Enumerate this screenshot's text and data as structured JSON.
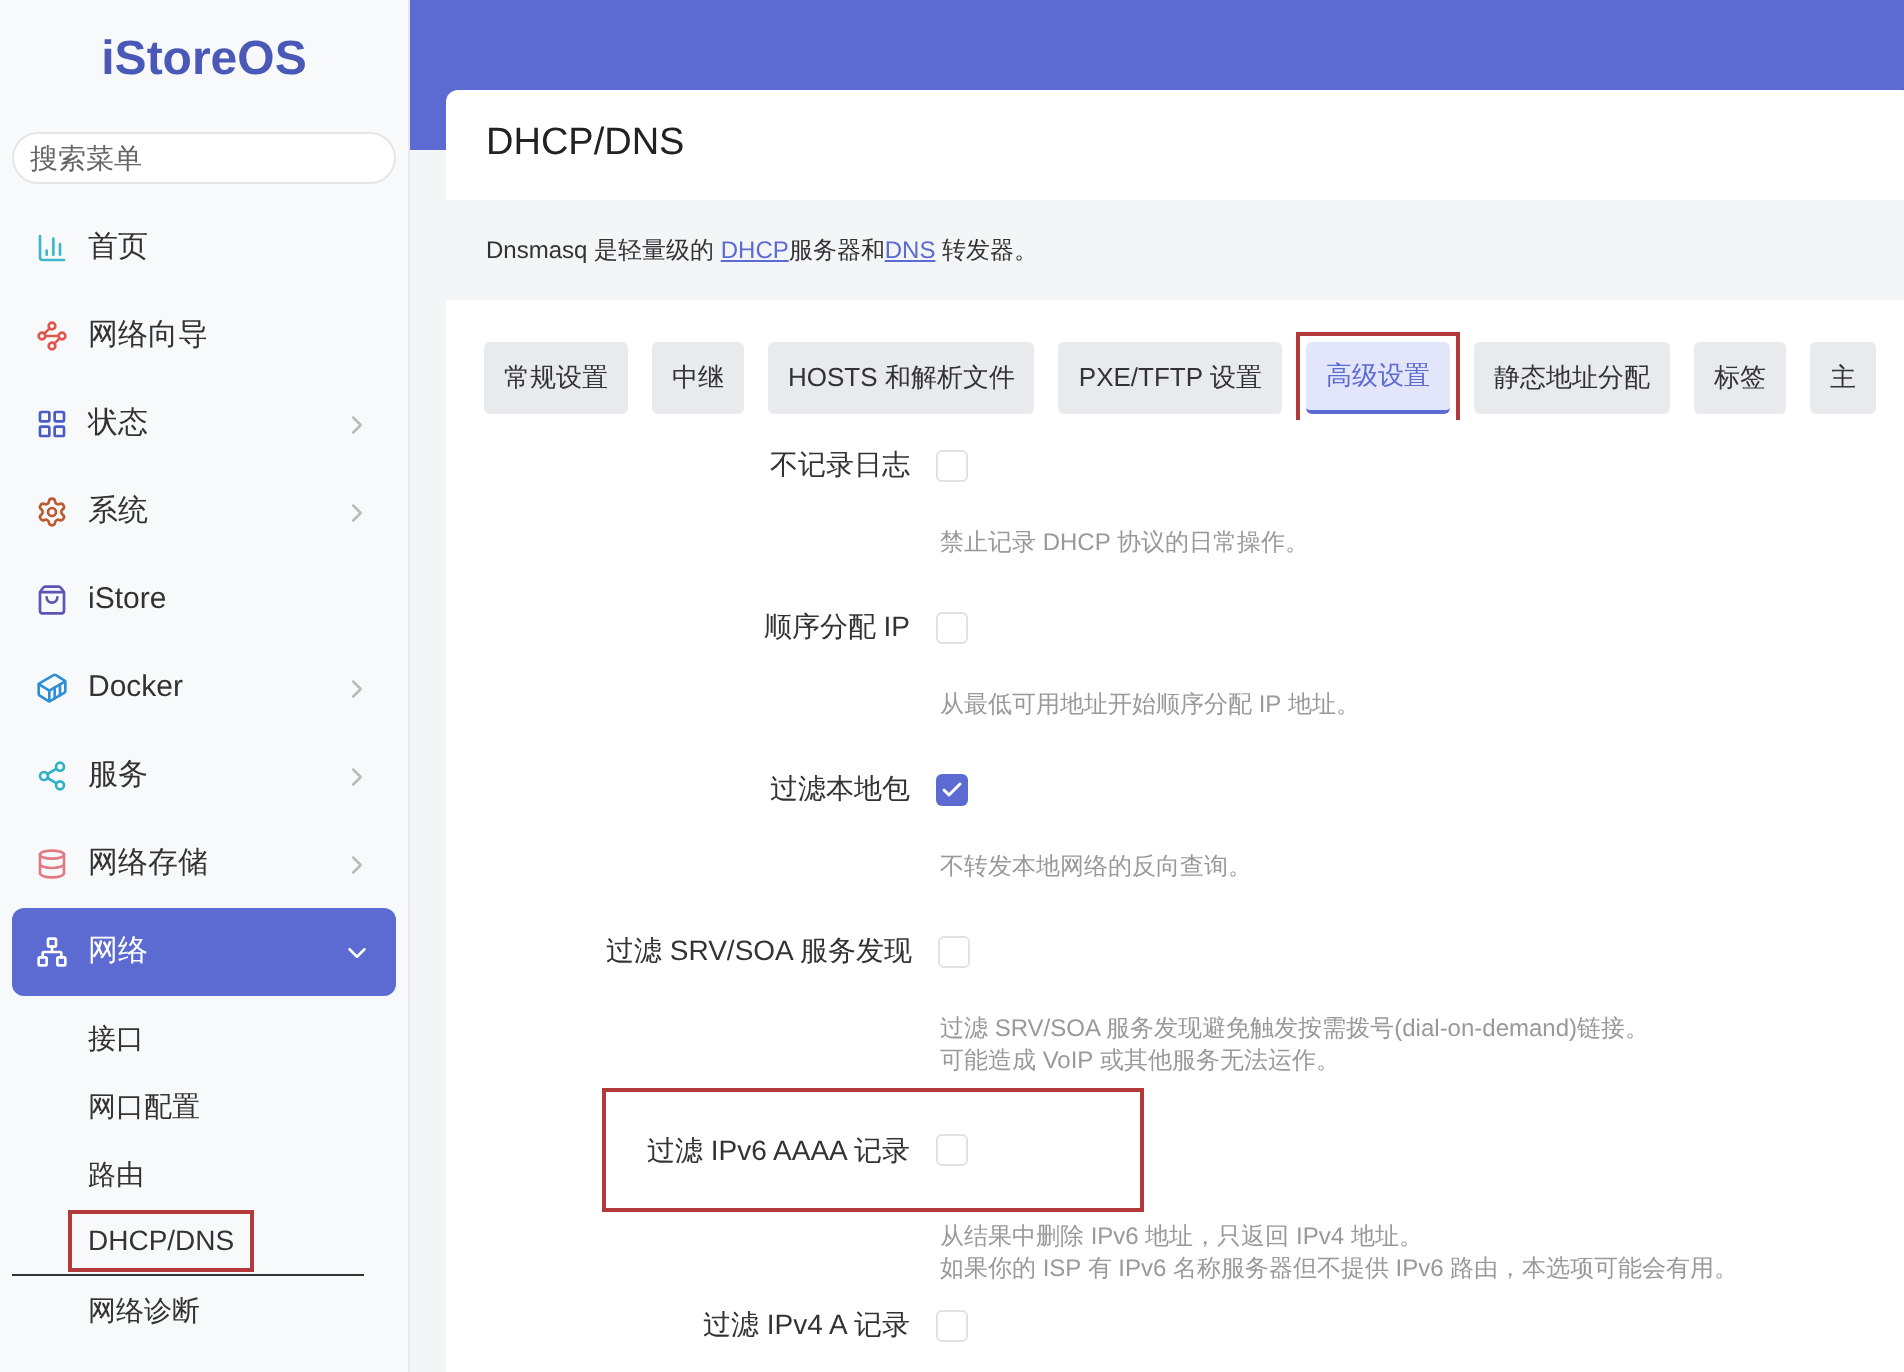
{
  "sidebar": {
    "logo": "iStoreOS",
    "search": {
      "placeholder": "搜索菜单"
    },
    "items": [
      {
        "kind": "home",
        "label": "首页",
        "has_children": false,
        "expanded": false
      },
      {
        "kind": "wizard",
        "label": "网络向导",
        "has_children": false,
        "expanded": false
      },
      {
        "kind": "status",
        "label": "状态",
        "has_children": true,
        "expanded": false
      },
      {
        "kind": "system",
        "label": "系统",
        "has_children": true,
        "expanded": false
      },
      {
        "kind": "store",
        "label": "iStore",
        "has_children": false,
        "expanded": false
      },
      {
        "kind": "docker",
        "label": "Docker",
        "has_children": true,
        "expanded": false
      },
      {
        "kind": "services",
        "label": "服务",
        "has_children": true,
        "expanded": false
      },
      {
        "kind": "storage",
        "label": "网络存储",
        "has_children": true,
        "expanded": false
      },
      {
        "kind": "network",
        "label": "网络",
        "has_children": true,
        "expanded": true,
        "children": [
          {
            "label": "接口",
            "selected": false,
            "highlighted": false
          },
          {
            "label": "网口配置",
            "selected": false,
            "highlighted": false
          },
          {
            "label": "路由",
            "selected": false,
            "highlighted": false
          },
          {
            "label": "DHCP/DNS",
            "selected": true,
            "highlighted": true
          },
          {
            "label": "网络诊断",
            "selected": false,
            "highlighted": false
          }
        ]
      }
    ]
  },
  "page": {
    "title": "DHCP/DNS",
    "intro": {
      "prefix": "Dnsmasq 是轻量级的 ",
      "link1": "DHCP",
      "middle": "服务器和",
      "link2": "DNS",
      "suffix": " 转发器。"
    },
    "tabs": [
      {
        "label": "常规设置",
        "selected": false,
        "highlighted": false
      },
      {
        "label": "中继",
        "selected": false,
        "highlighted": false
      },
      {
        "label": "HOSTS 和解析文件",
        "selected": false,
        "highlighted": false
      },
      {
        "label": "PXE/TFTP 设置",
        "selected": false,
        "highlighted": false
      },
      {
        "label": "高级设置",
        "selected": true,
        "highlighted": true
      },
      {
        "label": "静态地址分配",
        "selected": false,
        "highlighted": false
      },
      {
        "label": "标签",
        "selected": false,
        "highlighted": false
      },
      {
        "label": "主",
        "selected": false,
        "highlighted": false
      }
    ],
    "options": [
      {
        "label": "不记录日志",
        "checked": false,
        "highlighted": false,
        "description": [
          "禁止记录 DHCP 协议的日常操作。"
        ]
      },
      {
        "label": "顺序分配 IP",
        "checked": false,
        "highlighted": false,
        "description": [
          "从最低可用地址开始顺序分配 IP 地址。"
        ]
      },
      {
        "label": "过滤本地包",
        "checked": true,
        "highlighted": false,
        "description": [
          "不转发本地网络的反向查询。"
        ]
      },
      {
        "label": "过滤 SRV/SOA 服务发现",
        "checked": false,
        "highlighted": false,
        "description": [
          "过滤 SRV/SOA 服务发现避免触发按需拨号(dial-on-demand)链接。",
          "可能造成 VoIP 或其他服务无法运作。"
        ]
      },
      {
        "label": "过滤 IPv6 AAAA 记录",
        "checked": false,
        "highlighted": true,
        "description": [
          "从结果中删除 IPv6 地址，只返回 IPv4 地址。",
          "如果你的 ISP 有 IPv6 名称服务器但不提供 IPv6 路由，本选项可能会有用。"
        ]
      },
      {
        "label": "过滤 IPv4 A 记录",
        "checked": false,
        "highlighted": false
      }
    ]
  }
}
